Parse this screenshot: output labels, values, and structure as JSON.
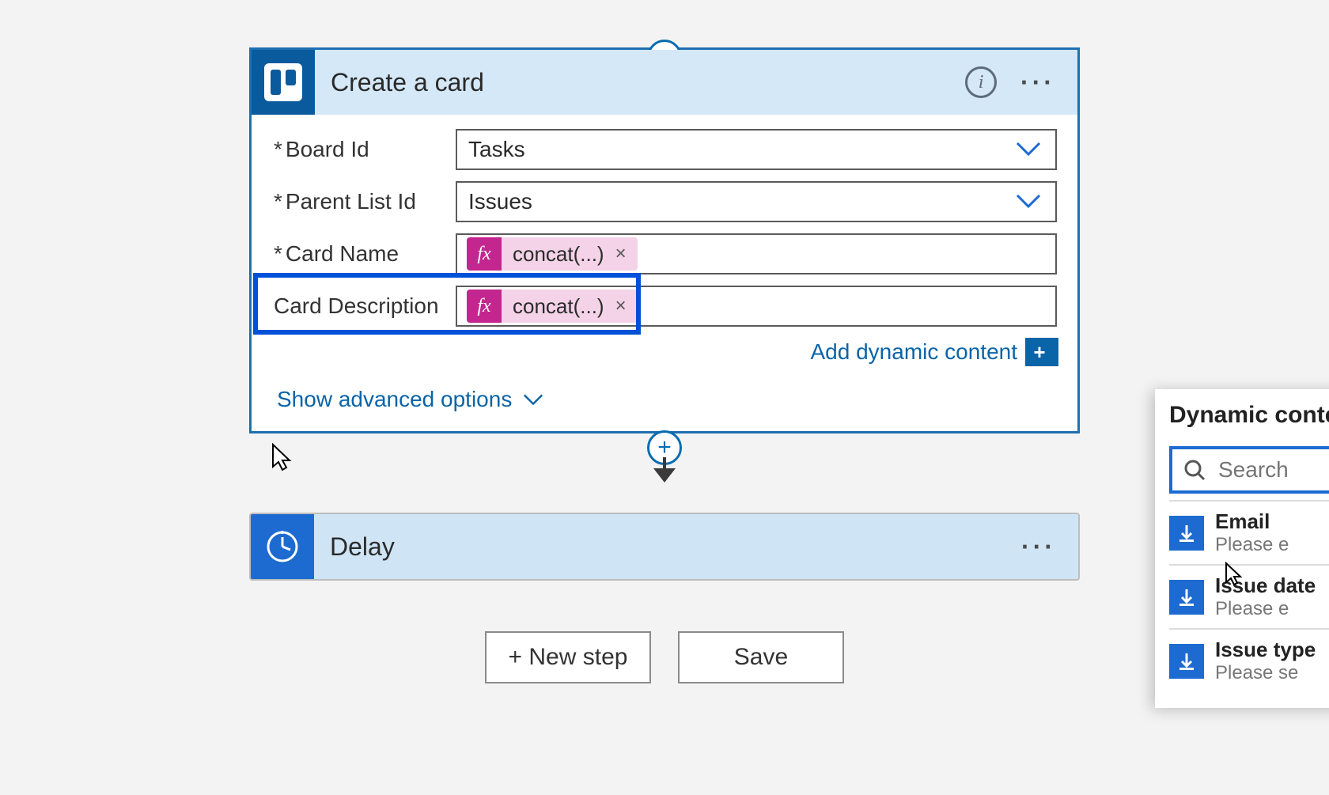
{
  "action": {
    "title": "Create a card",
    "fields": {
      "board_id": {
        "label": "Board Id",
        "value": "Tasks",
        "required": true
      },
      "parent_list_id": {
        "label": "Parent List Id",
        "value": "Issues",
        "required": true
      },
      "card_name": {
        "label": "Card Name",
        "token": "concat(...)",
        "required": true
      },
      "card_description": {
        "label": "Card Description",
        "token": "concat(...)",
        "required": false
      }
    },
    "add_dynamic_label": "Add dynamic content",
    "show_advanced_label": "Show advanced options"
  },
  "delay": {
    "title": "Delay"
  },
  "buttons": {
    "new_step": "+ New step",
    "save": "Save"
  },
  "dynamic_panel": {
    "tab": "Dynamic content",
    "search_placeholder": "Search",
    "items": [
      {
        "title": "Email",
        "sub": "Please e"
      },
      {
        "title": "Issue date",
        "sub": "Please e"
      },
      {
        "title": "Issue type",
        "sub": "Please se"
      }
    ]
  },
  "fx_symbol": "fx",
  "token_remove": "×"
}
